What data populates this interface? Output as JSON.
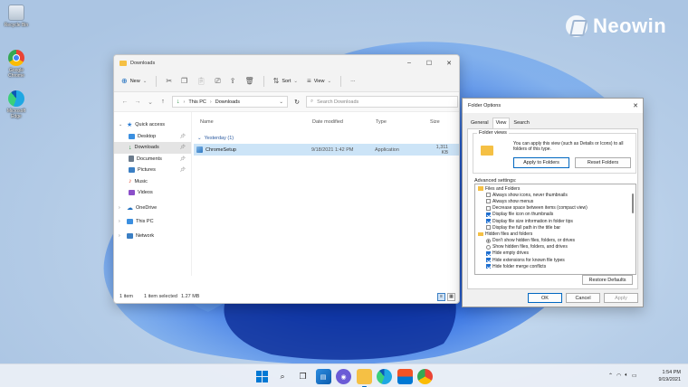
{
  "desktop": {
    "icons": [
      {
        "label": "Recycle Bin"
      },
      {
        "label": "Google Chrome"
      },
      {
        "label": "Microsoft Edge"
      }
    ],
    "watermark": "Neowin"
  },
  "explorer": {
    "title": "Downloads",
    "toolbar": {
      "new": "New",
      "sort": "Sort",
      "view": "View",
      "more": "···"
    },
    "address": {
      "path": [
        "This PC",
        "Downloads"
      ],
      "search_placeholder": "Search Downloads"
    },
    "nav": [
      {
        "label": "Quick access",
        "color": "#2b7cd3"
      },
      {
        "label": "Desktop",
        "color": "#3b8fe0",
        "pinned": true
      },
      {
        "label": "Downloads",
        "color": "#1f8a3b",
        "pinned": true,
        "selected": true
      },
      {
        "label": "Documents",
        "color": "#6b7b8c",
        "pinned": true
      },
      {
        "label": "Pictures",
        "color": "#3b7fc4",
        "pinned": true
      },
      {
        "label": "Music",
        "color": "#e0503a"
      },
      {
        "label": "Videos",
        "color": "#8b4fc9"
      },
      {
        "label": "OneDrive",
        "color": "#1f6fbf"
      },
      {
        "label": "This PC",
        "color": "#3b8fe0"
      },
      {
        "label": "Network",
        "color": "#3b7fc4"
      }
    ],
    "columns": [
      "Name",
      "Date modified",
      "Type",
      "Size"
    ],
    "group": "Yesterday (1)",
    "files": [
      {
        "name": "ChromeSetup",
        "date": "9/18/2021 1:42 PM",
        "type": "Application",
        "size": "1,311 KB"
      }
    ],
    "status": {
      "count": "1 item",
      "selected": "1 item selected",
      "size": "1.27 MB"
    }
  },
  "folder_options": {
    "title": "Folder Options",
    "tabs": [
      "General",
      "View",
      "Search"
    ],
    "active_tab": "View",
    "folder_views": {
      "caption": "Folder views",
      "description": "You can apply this view (such as Details or Icons) to all folders of this type.",
      "apply_button": "Apply to Folders",
      "reset_button": "Reset Folders"
    },
    "advanced_caption": "Advanced settings:",
    "advanced": [
      {
        "type": "folder",
        "label": "Files and Folders"
      },
      {
        "type": "check",
        "checked": false,
        "label": "Always show icons, never thumbnails"
      },
      {
        "type": "check",
        "checked": false,
        "label": "Always show menus"
      },
      {
        "type": "check",
        "checked": false,
        "label": "Decrease space between items (compact view)"
      },
      {
        "type": "check",
        "checked": true,
        "label": "Display file icon on thumbnails"
      },
      {
        "type": "check",
        "checked": true,
        "label": "Display file size information in folder tips"
      },
      {
        "type": "check",
        "checked": false,
        "label": "Display the full path in the title bar"
      },
      {
        "type": "folder",
        "label": "Hidden files and folders"
      },
      {
        "type": "radio",
        "checked": true,
        "label": "Don't show hidden files, folders, or drives"
      },
      {
        "type": "radio",
        "checked": false,
        "label": "Show hidden files, folders, and drives"
      },
      {
        "type": "check",
        "checked": true,
        "label": "Hide empty drives"
      },
      {
        "type": "check",
        "checked": true,
        "label": "Hide extensions for known file types"
      },
      {
        "type": "check",
        "checked": true,
        "label": "Hide folder merge conflicts"
      }
    ],
    "restore_button": "Restore Defaults",
    "ok": "OK",
    "cancel": "Cancel",
    "apply": "Apply"
  },
  "taskbar": {
    "time": "1:54 PM",
    "date": "9/19/2021",
    "apps": [
      "start",
      "search",
      "task-view",
      "widgets",
      "chat",
      "file-explorer",
      "edge",
      "store",
      "chrome"
    ]
  }
}
